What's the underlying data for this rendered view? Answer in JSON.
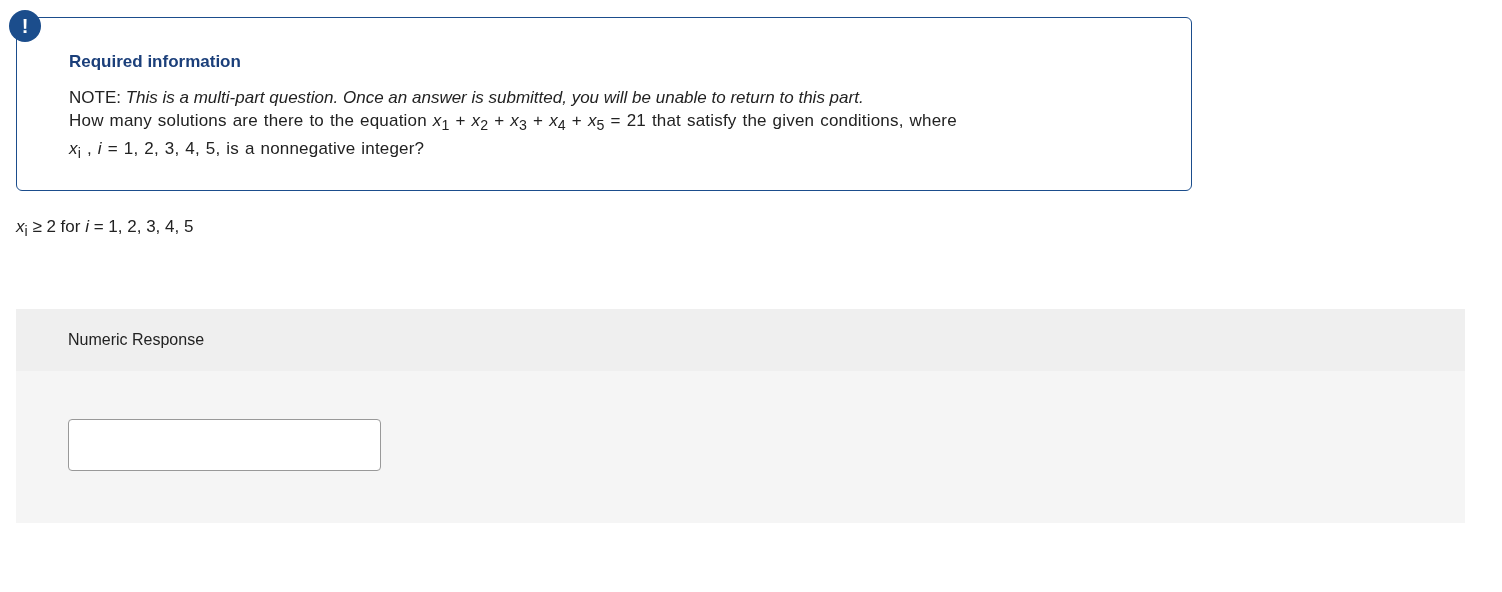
{
  "alert": {
    "icon": "!",
    "title": "Required information",
    "note": "NOTE: *This is a multi-part question. Once an answer is submitted, you will be unable to return to this part.*",
    "question": "How many solutions are there to the equation *x*$_{1}$ + *x*$_{2}$ + *x*$_{3}$ + *x*$_{4}$ + *x*$_{5}$ = 21 that satisfy the given conditions, where *x*$_{i}$ , *i* = 1, 2, 3, 4, 5, is a nonnegative integer?"
  },
  "condition": "*x*$_{i}$ ≥ 2 for *i* = 1, 2, 3, 4, 5",
  "response": {
    "title": "Numeric Response"
  }
}
